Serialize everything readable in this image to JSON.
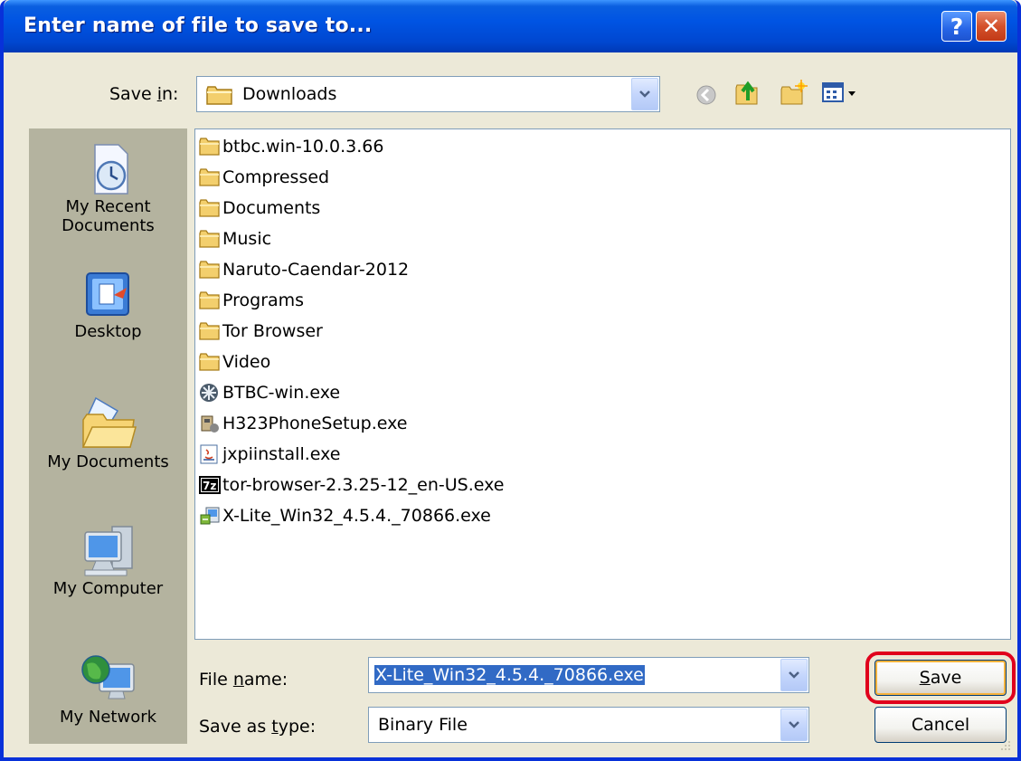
{
  "dialog": {
    "title": "Enter name of file to save to...",
    "help_glyph": "?",
    "close_glyph": "✕"
  },
  "save_in": {
    "label_prefix": "Save ",
    "label_accel": "i",
    "label_suffix": "n:",
    "value": "Downloads"
  },
  "places": [
    {
      "label_line1": "My Recent",
      "label_line2": "Documents",
      "icon": "recent-documents-icon"
    },
    {
      "label_line1": "Desktop",
      "label_line2": "",
      "icon": "desktop-icon"
    },
    {
      "label_line1": "My Documents",
      "label_line2": "",
      "icon": "my-documents-icon"
    },
    {
      "label_line1": "My Computer",
      "label_line2": "",
      "icon": "my-computer-icon"
    },
    {
      "label_line1": "My Network",
      "label_line2": "",
      "icon": "my-network-icon"
    }
  ],
  "files": [
    {
      "name": "btbc.win-10.0.3.66",
      "icon": "folder-icon"
    },
    {
      "name": "Compressed",
      "icon": "folder-icon"
    },
    {
      "name": "Documents",
      "icon": "folder-icon"
    },
    {
      "name": "Music",
      "icon": "folder-icon"
    },
    {
      "name": "Naruto-Caendar-2012",
      "icon": "folder-icon"
    },
    {
      "name": "Programs",
      "icon": "folder-icon"
    },
    {
      "name": "Tor Browser",
      "icon": "folder-icon"
    },
    {
      "name": "Video",
      "icon": "folder-icon"
    },
    {
      "name": "BTBC-win.exe",
      "icon": "btbc-exe-icon"
    },
    {
      "name": "H323PhoneSetup.exe",
      "icon": "setup-exe-icon"
    },
    {
      "name": "jxpiinstall.exe",
      "icon": "java-exe-icon"
    },
    {
      "name": "tor-browser-2.3.25-12_en-US.exe",
      "icon": "7z-exe-icon"
    },
    {
      "name": "X-Lite_Win32_4.5.4._70866.exe",
      "icon": "installer-exe-icon"
    }
  ],
  "file_name": {
    "label_prefix": "File ",
    "label_accel": "n",
    "label_suffix": "ame:",
    "value": "X-Lite_Win32_4.5.4._70866.exe"
  },
  "save_as_type": {
    "label_prefix": "Save as ",
    "label_accel": "t",
    "label_suffix": "ype:",
    "value": "Binary File"
  },
  "buttons": {
    "save_accel": "S",
    "save_rest": "ave",
    "cancel": "Cancel"
  },
  "colors": {
    "titlebar": "#0054e3",
    "dialog_bg": "#ece9d8",
    "places_bg": "#b4b39f",
    "selection": "#316ac5",
    "highlight": "#e0001c"
  }
}
